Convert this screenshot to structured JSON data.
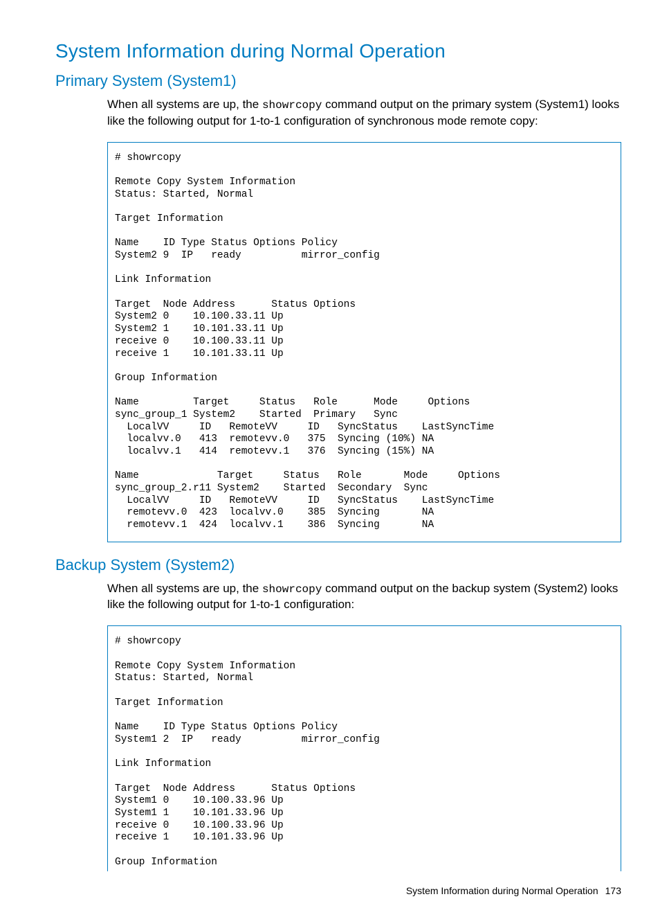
{
  "headings": {
    "main": "System Information during Normal Operation",
    "primary": "Primary System (System1)",
    "backup": "Backup System (System2)"
  },
  "paragraphs": {
    "primary_before": "When all systems are up, the ",
    "primary_code": "showrcopy",
    "primary_after": " command output on the primary system (System1) looks like the following output for 1-to-1 configuration of synchronous mode remote copy:",
    "backup_before": "When all systems are up, the ",
    "backup_code": "showrcopy",
    "backup_after": " command output on the backup system (System2) looks like the following output for 1-to-1 configuration:"
  },
  "code_blocks": {
    "primary": "# showrcopy\n\nRemote Copy System Information\nStatus: Started, Normal\n\nTarget Information\n\nName    ID Type Status Options Policy\nSystem2 9  IP   ready          mirror_config\n\nLink Information\n\nTarget  Node Address      Status Options\nSystem2 0    10.100.33.11 Up\nSystem2 1    10.101.33.11 Up\nreceive 0    10.100.33.11 Up\nreceive 1    10.101.33.11 Up\n\nGroup Information\n\nName         Target     Status   Role      Mode     Options\nsync_group_1 System2    Started  Primary   Sync\n  LocalVV     ID   RemoteVV     ID   SyncStatus    LastSyncTime\n  localvv.0   413  remotevv.0   375  Syncing (10%) NA\n  localvv.1   414  remotevv.1   376  Syncing (15%) NA\n\nName             Target     Status   Role       Mode     Options\nsync_group_2.r11 System2    Started  Secondary  Sync\n  LocalVV     ID   RemoteVV     ID   SyncStatus    LastSyncTime\n  remotevv.0  423  localvv.0    385  Syncing       NA\n  remotevv.1  424  localvv.1    386  Syncing       NA",
    "backup": "# showrcopy\n\nRemote Copy System Information\nStatus: Started, Normal\n\nTarget Information\n\nName    ID Type Status Options Policy\nSystem1 2  IP   ready          mirror_config\n\nLink Information\n\nTarget  Node Address      Status Options\nSystem1 0    10.100.33.96 Up\nSystem1 1    10.101.33.96 Up\nreceive 0    10.100.33.96 Up\nreceive 1    10.101.33.96 Up\n\nGroup Information"
  },
  "footer": {
    "title": "System Information during Normal Operation",
    "page": "173"
  }
}
